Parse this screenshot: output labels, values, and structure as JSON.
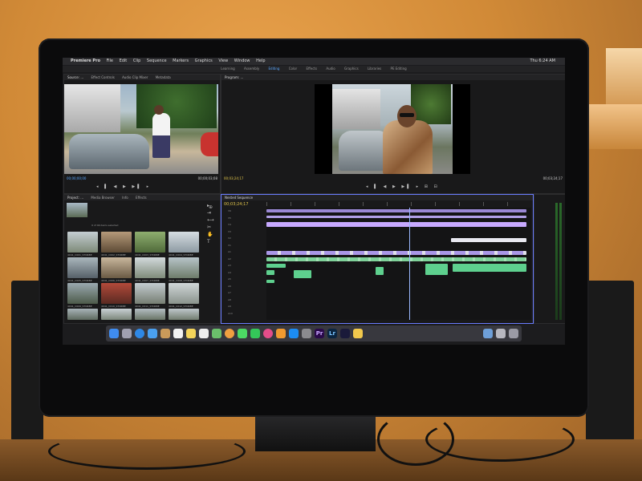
{
  "app": {
    "name": "Premiere Pro",
    "menu": [
      "File",
      "Edit",
      "Clip",
      "Sequence",
      "Markers",
      "Graphics",
      "View",
      "Window",
      "Help"
    ],
    "clock": "Thu 6:24 AM"
  },
  "workspaces": [
    "Learning",
    "Assembly",
    "Editing",
    "Color",
    "Effects",
    "Audio",
    "Graphics",
    "Libraries",
    "PE Editing"
  ],
  "active_workspace": "Editing",
  "source_monitor": {
    "tabs": [
      "Source: ...",
      "Effect Controls",
      "Audio Clip Mixer",
      "Metadata"
    ],
    "timecode_in": "00;00;00;00",
    "timecode_out": "00;00;03;08"
  },
  "program_monitor": {
    "tab": "Program: ...",
    "timecode_in": "00;03;24;17",
    "timecode_out": "00;03;24;17"
  },
  "project_panel": {
    "tabs": [
      "Project: ...",
      "Media Browser",
      "Info",
      "Effects"
    ],
    "item_count": "9 of 46 items selected",
    "clips": [
      "4041_C001_STORBE",
      "4041_C002_STORBE",
      "4041_C003_STORBE",
      "4041_C004_STORBE",
      "4041_C005_STORBE",
      "4041_C006_STORBE",
      "4041_C007_STORBE",
      "4041_C008_STORBE",
      "4041_C009_STORBE",
      "4041_C010_STORBE",
      "4041_C011_STORBE",
      "4041_C012_STORBE"
    ]
  },
  "timeline": {
    "tab": "Nested Sequence",
    "timecode": "00;03;24;17",
    "tracks": [
      "V6",
      "V5",
      "V4",
      "V3",
      "V2",
      "V1",
      "A1",
      "A2",
      "A3",
      "A4",
      "A5",
      "A6",
      "A7",
      "A8",
      "A9",
      "A10"
    ]
  },
  "colors": {
    "accent": "#5aa8ff",
    "video_clip": "#c7a9ff",
    "audio_clip": "#5ed08e",
    "panel": "#19191a"
  },
  "dock_icons": [
    "finder-icon",
    "launchpad-icon",
    "safari-icon",
    "mail-icon",
    "contacts-icon",
    "calendar-icon",
    "notes-icon",
    "reminders-icon",
    "maps-icon",
    "photos-icon",
    "messages-icon",
    "facetime-icon",
    "itunes-icon",
    "ibooks-icon",
    "appstore-icon",
    "preferences-icon",
    "premiere-icon",
    "lightroom-icon",
    "media-encoder-icon",
    "folder-icon",
    "trash-icon"
  ],
  "dock_labels": {
    "premiere": "Pr",
    "lightroom": "Lr"
  }
}
